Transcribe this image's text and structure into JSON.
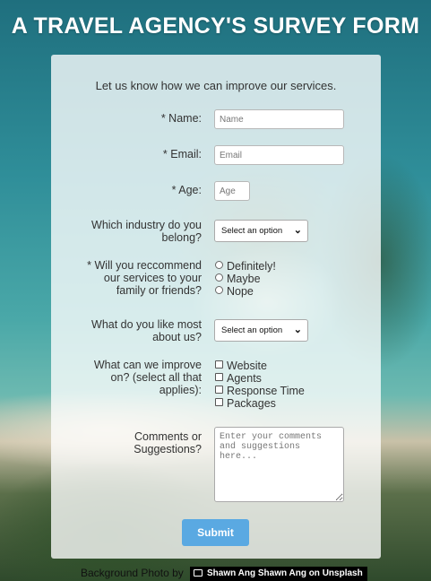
{
  "title": "A TRAVEL AGENCY'S SURVEY FORM",
  "intro": "Let us know how we can improve our services.",
  "fields": {
    "name": {
      "label": "* Name:",
      "placeholder": "Name"
    },
    "email": {
      "label": "* Email:",
      "placeholder": "Email"
    },
    "age": {
      "label": "* Age:",
      "placeholder": "Age"
    },
    "industry": {
      "label_line1": "Which industry do you",
      "label_line2": "belong?",
      "selected": "Select an option"
    },
    "recommend": {
      "label_line1": "* Will you reccommend",
      "label_line2": "our services to your",
      "label_line3": "family or friends?",
      "options": [
        "Definitely!",
        "Maybe",
        "Nope"
      ]
    },
    "like_most": {
      "label_line1": "What do you like most",
      "label_line2": "about us?",
      "selected": "Select an option"
    },
    "improve": {
      "label_line1": "What can we improve",
      "label_line2": "on? (select all that",
      "label_line3": "applies):",
      "options": [
        "Website",
        "Agents",
        "Response Time",
        "Packages"
      ]
    },
    "comments": {
      "label_line1": "Comments or",
      "label_line2": "Suggestions?",
      "placeholder": "Enter your comments and suggestions here..."
    }
  },
  "submit_label": "Submit",
  "credit": {
    "prefix": "Background Photo by",
    "badge": "Shawn Ang Shawn Ang on Unsplash"
  }
}
